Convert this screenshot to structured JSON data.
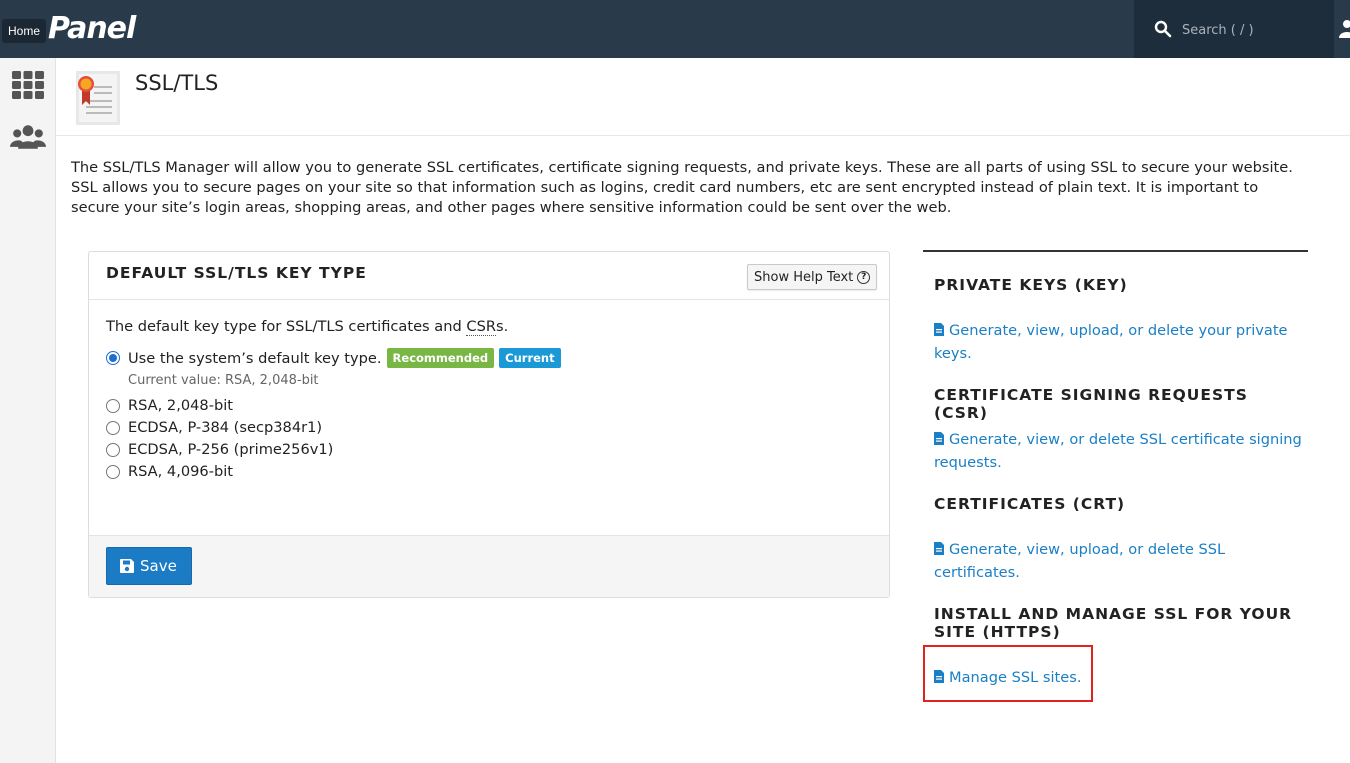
{
  "topbar": {
    "home_tooltip": "Home",
    "logo_text": "Panel",
    "search_placeholder": "Search ( / )"
  },
  "sidebar": {
    "items": [
      {
        "icon": "grid-icon"
      },
      {
        "icon": "users-icon"
      }
    ]
  },
  "page": {
    "title": "SSL/TLS",
    "intro": "The SSL/TLS Manager will allow you to generate SSL certificates, certificate signing requests, and private keys. These are all parts of using SSL to secure your website. SSL allows you to secure pages on your site so that information such as logins, credit card numbers, etc are sent encrypted instead of plain text. It is important to secure your site’s login areas, shopping areas, and other pages where sensitive information could be sent over the web."
  },
  "key_type_panel": {
    "title": "DEFAULT SSL/TLS KEY TYPE",
    "help_button": "Show Help Text",
    "description_prefix": "The default key type for SSL/TLS certificates and ",
    "description_abbr": "CSR",
    "description_suffix": "s.",
    "options": [
      {
        "label": "Use the system’s default key type.",
        "selected": true
      },
      {
        "label": "RSA, 2,048-bit",
        "selected": false
      },
      {
        "label": "ECDSA, P-384 (secp384r1)",
        "selected": false
      },
      {
        "label": "ECDSA, P-256 (prime256v1)",
        "selected": false
      },
      {
        "label": "RSA, 4,096-bit",
        "selected": false
      }
    ],
    "badge_recommended": "Recommended",
    "badge_current": "Current",
    "current_value": "Current value: RSA, 2,048-bit",
    "save_label": "Save"
  },
  "right_column": {
    "sections": [
      {
        "title": "PRIVATE KEYS (KEY)",
        "link": "Generate, view, upload, or delete your private keys."
      },
      {
        "title": "CERTIFICATE SIGNING REQUESTS (CSR)",
        "link": "Generate, view, or delete SSL certificate signing requests."
      },
      {
        "title": "CERTIFICATES (CRT)",
        "link": "Generate, view, upload, or delete SSL certificates."
      },
      {
        "title": "INSTALL AND MANAGE SSL FOR YOUR SITE (HTTPS)",
        "link": "Manage SSL sites."
      }
    ]
  },
  "colors": {
    "topbar": "#293a4a",
    "link": "#1a7fc4",
    "save_button": "#1b7bc4",
    "badge_recommended": "#78b744",
    "badge_current": "#1a99d6",
    "highlight_border": "#e0241b"
  }
}
